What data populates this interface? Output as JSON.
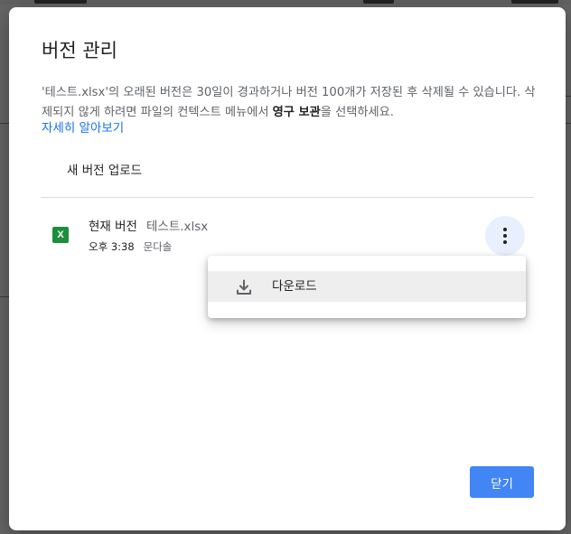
{
  "dialog": {
    "title": "버전 관리",
    "description_part1": "'테스트.xlsx'의 오래된 버전은 30일이 경과하거나 버전 100개가 저장된 후 삭제될 수 있습니다. 삭제되지 않게 하려면 파일의 컨텍스트 메뉴에서 ",
    "description_bold": "영구 보관",
    "description_part2": "을 선택하세요.",
    "learn_more": "자세히 알아보기",
    "upload_label": "새 버전 업로드",
    "close_label": "닫기"
  },
  "version": {
    "icon_letter": "X",
    "label": "현재 버전",
    "file_name": "테스트.xlsx",
    "time": "오후 3:38",
    "user": "문다솔"
  },
  "menu": {
    "items": [
      {
        "label": "다운로드",
        "icon": "download-icon"
      }
    ]
  },
  "colors": {
    "accent": "#4285f4",
    "link": "#1a73e8",
    "file_icon": "#1e8e3e",
    "menu_hover": "#eeeeee",
    "more_button_bg": "#e8f0fe"
  }
}
